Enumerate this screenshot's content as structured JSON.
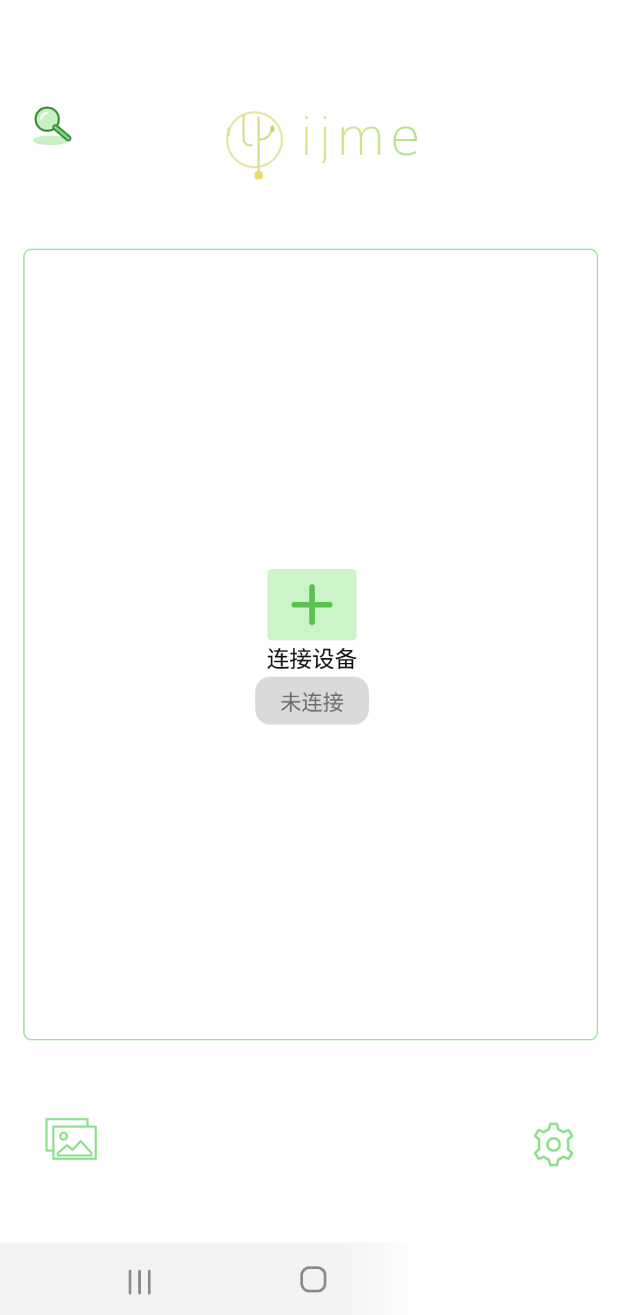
{
  "app": {
    "brand": "ijme"
  },
  "header": {
    "search_icon": "search-icon",
    "logo_icon": "cactus-logo-icon"
  },
  "device_panel": {
    "add_icon": "plus-icon",
    "connect_label": "连接设备",
    "status_label": "未连接"
  },
  "bottom_bar": {
    "gallery_icon": "gallery-icon",
    "settings_icon": "gear-icon"
  },
  "system_nav": {
    "recents_icon": "recents-icon",
    "home_icon": "home-icon"
  },
  "colors": {
    "accent": "#5cc24f",
    "panel_border": "#9be19a",
    "add_button_bg": "#cdf3cb",
    "status_bg": "#dadada",
    "status_text": "#6e6e6e"
  }
}
